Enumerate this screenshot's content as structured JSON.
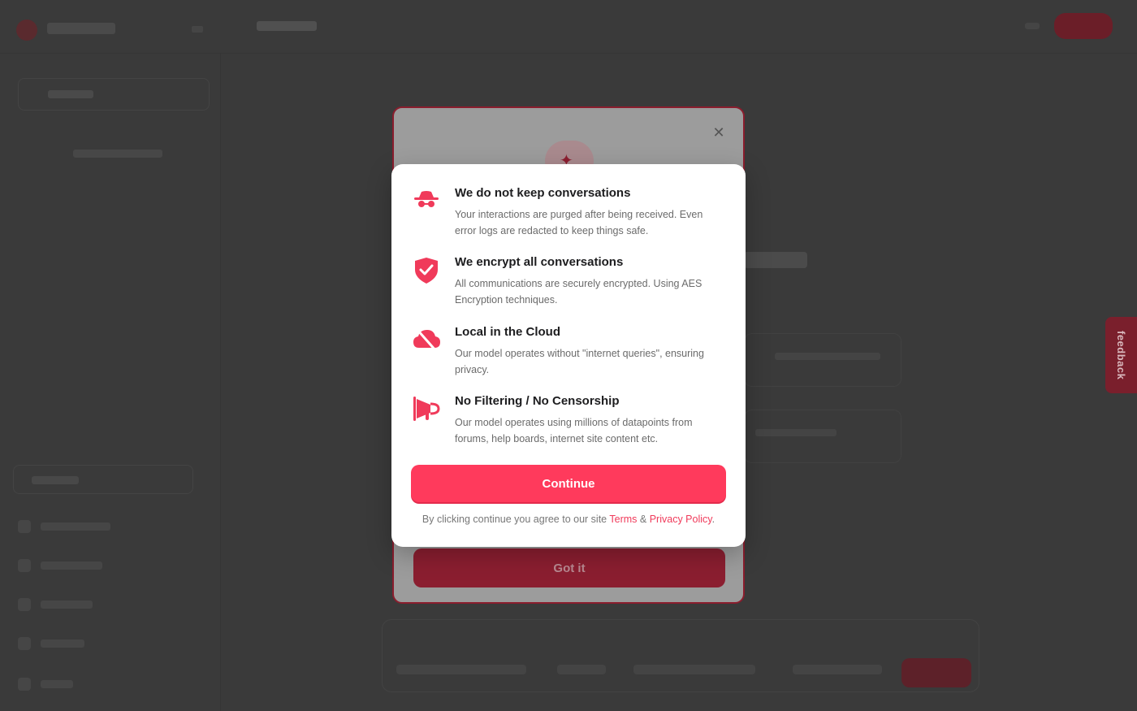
{
  "modal": {
    "features": [
      {
        "icon": "incognito-icon",
        "title": "We do not keep conversations",
        "desc": "Your interactions are purged after being received. Even error logs are redacted to keep things safe."
      },
      {
        "icon": "shield-check-icon",
        "title": "We encrypt all conversations",
        "desc": "All communications are securely encrypted. Using AES Encryption techniques."
      },
      {
        "icon": "cloud-off-icon",
        "title": "Local in the Cloud",
        "desc": "Our model operates without \"internet queries\", ensuring privacy."
      },
      {
        "icon": "megaphone-icon",
        "title": "No Filtering / No Censorship",
        "desc": "Our model operates using millions of datapoints from forums, help boards, internet site content etc."
      }
    ],
    "continue_label": "Continue",
    "agree_prefix": "By clicking continue you agree to our site",
    "terms_label": "Terms",
    "amp": "&",
    "privacy_label": "Privacy Policy",
    "agree_suffix": "."
  },
  "back_modal": {
    "close_icon": "close-icon",
    "badge_icon": "sparkles-icon",
    "gotit_label": "Got it"
  },
  "feedback_label": "feedback",
  "colors": {
    "accent": "#ff3a5c",
    "link": "#f03a5a",
    "overlay_bg": "#3b3b3b"
  }
}
